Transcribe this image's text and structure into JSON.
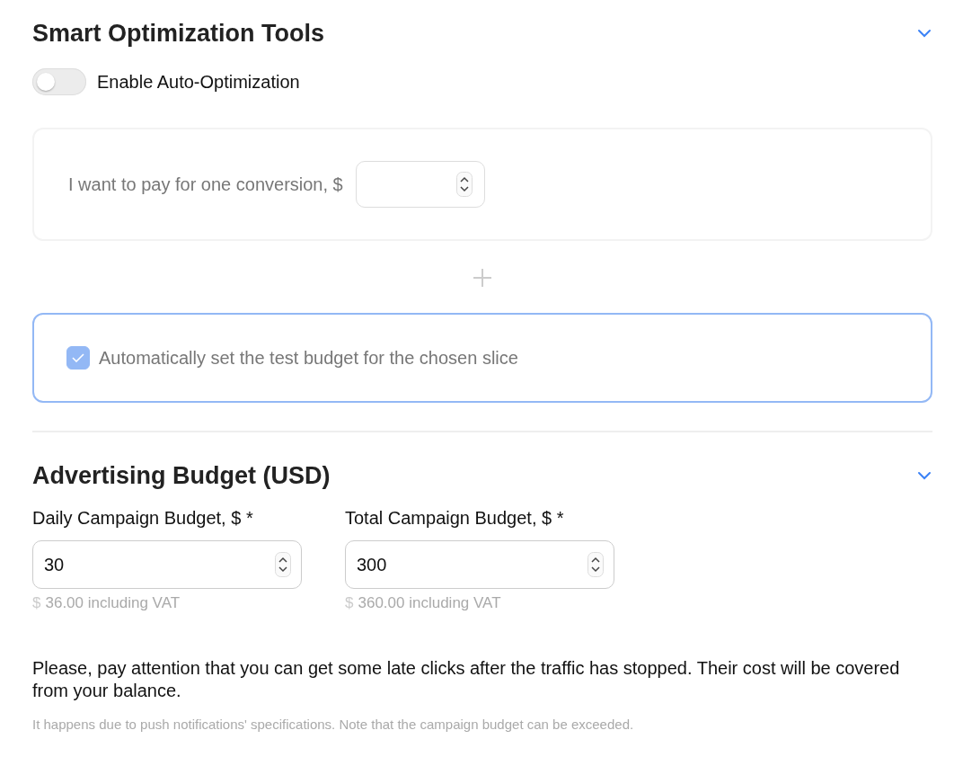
{
  "optimization": {
    "title": "Smart Optimization Tools",
    "expanded": true,
    "toggle": {
      "label": "Enable Auto-Optimization",
      "on": false
    },
    "conversion": {
      "label": "I want to pay for one conversion, $"
    },
    "test_budget": {
      "label": "Automatically set the test budget for the chosen slice",
      "checked": true
    }
  },
  "budget": {
    "title": "Advertising Budget (USD)",
    "expanded": true,
    "fields": [
      {
        "label": "Daily Campaign Budget, $ *",
        "value": "30",
        "currency": "$",
        "hint": "36.00 including VAT"
      },
      {
        "label": "Total Campaign Budget, $ *",
        "value": "300",
        "currency": "$",
        "hint": "360.00 including VAT"
      }
    ],
    "notice": "Please, pay attention that you can get some late clicks after the traffic has stopped. Their cost will be covered from your balance.",
    "note": "It happens due to push notifications' specifications. Note that the campaign budget can be exceeded."
  }
}
